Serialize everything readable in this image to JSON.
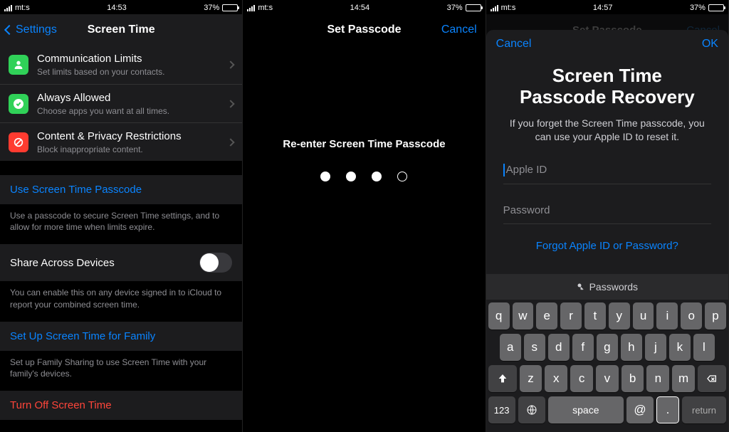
{
  "status": {
    "carrier": "mt:s",
    "battery": "37%"
  },
  "phone1": {
    "time": "14:53",
    "nav": {
      "back": "Settings",
      "title": "Screen Time"
    },
    "rows": [
      {
        "icon": "contact-icon",
        "color": "#30d158",
        "title": "Communication Limits",
        "sub": "Set limits based on your contacts."
      },
      {
        "icon": "check-icon",
        "color": "#30d158",
        "title": "Always Allowed",
        "sub": "Choose apps you want at all times."
      },
      {
        "icon": "block-icon",
        "color": "#ff3b30",
        "title": "Content & Privacy Restrictions",
        "sub": "Block inappropriate content."
      }
    ],
    "use_passcode": "Use Screen Time Passcode",
    "use_passcode_footer": "Use a passcode to secure Screen Time settings, and to allow for more time when limits expire.",
    "share_label": "Share Across Devices",
    "share_footer": "You can enable this on any device signed in to iCloud to report your combined screen time.",
    "family_link": "Set Up Screen Time for Family",
    "family_footer": "Set up Family Sharing to use Screen Time with your family's devices.",
    "turn_off": "Turn Off Screen Time"
  },
  "phone2": {
    "time": "14:54",
    "nav": {
      "title": "Set Passcode",
      "cancel": "Cancel"
    },
    "prompt": "Re-enter Screen Time Passcode",
    "entered_digits": 3,
    "total_digits": 4
  },
  "phone3": {
    "time": "14:57",
    "dim": {
      "title": "Set Passcode",
      "cancel": "Cancel"
    },
    "modal": {
      "cancel": "Cancel",
      "ok": "OK",
      "title_line1": "Screen Time",
      "title_line2": "Passcode Recovery",
      "desc": "If you forget the Screen Time passcode, you can use your Apple ID to reset it.",
      "apple_id_placeholder": "Apple ID",
      "password_placeholder": "Password",
      "forgot": "Forgot Apple ID or Password?"
    },
    "keyboard": {
      "bar_label": "Passwords",
      "row1": [
        "q",
        "w",
        "e",
        "r",
        "t",
        "y",
        "u",
        "i",
        "o",
        "p"
      ],
      "row2": [
        "a",
        "s",
        "d",
        "f",
        "g",
        "h",
        "j",
        "k",
        "l"
      ],
      "row3": [
        "z",
        "x",
        "c",
        "v",
        "b",
        "n",
        "m"
      ],
      "num": "123",
      "space": "space",
      "at": "@",
      "dot": ".",
      "return": "return"
    }
  }
}
